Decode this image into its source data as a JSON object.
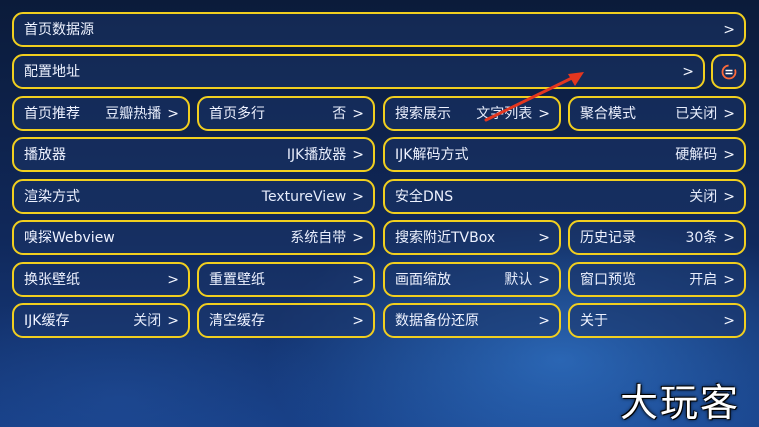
{
  "rows": {
    "home_source": {
      "label": "首页数据源",
      "chevron": ">"
    },
    "config_url": {
      "label": "配置地址",
      "chevron": ">"
    },
    "home_recommend": {
      "label": "首页推荐",
      "value": "豆瓣热播",
      "chevron": ">"
    },
    "home_multiline": {
      "label": "首页多行",
      "value": "否",
      "chevron": ">"
    },
    "search_display": {
      "label": "搜索展示",
      "value": "文字列表",
      "chevron": ">"
    },
    "aggregate_mode": {
      "label": "聚合模式",
      "value": "已关闭",
      "chevron": ">"
    },
    "player": {
      "label": "播放器",
      "value": "IJK播放器",
      "chevron": ">"
    },
    "ijk_decode": {
      "label": "IJK解码方式",
      "value": "硬解码",
      "chevron": ">"
    },
    "render_mode": {
      "label": "渲染方式",
      "value": "TextureView",
      "chevron": ">"
    },
    "secure_dns": {
      "label": "安全DNS",
      "value": "关闭",
      "chevron": ">"
    },
    "sniff_webview": {
      "label": "嗅探Webview",
      "value": "系统自带",
      "chevron": ">"
    },
    "search_nearby": {
      "label": "搜索附近TVBox",
      "chevron": ">"
    },
    "history": {
      "label": "历史记录",
      "value": "30条",
      "chevron": ">"
    },
    "change_wallpaper": {
      "label": "换张壁纸",
      "chevron": ">"
    },
    "reset_wallpaper": {
      "label": "重置壁纸",
      "chevron": ">"
    },
    "screen_scale": {
      "label": "画面缩放",
      "value": "默认",
      "chevron": ">"
    },
    "window_preview": {
      "label": "窗口预览",
      "value": "开启",
      "chevron": ">"
    },
    "ijk_cache": {
      "label": "IJK缓存",
      "value": "关闭",
      "chevron": ">"
    },
    "clear_cache": {
      "label": "清空缓存",
      "chevron": ">"
    },
    "backup_restore": {
      "label": "数据备份还原",
      "chevron": ">"
    },
    "about": {
      "label": "关于",
      "chevron": ">"
    }
  },
  "icons": {
    "refresh": "refresh-icon"
  },
  "colors": {
    "border": "#f1cf1f",
    "arrow": "#e3361f"
  },
  "watermark": {
    "text": "大玩客"
  }
}
